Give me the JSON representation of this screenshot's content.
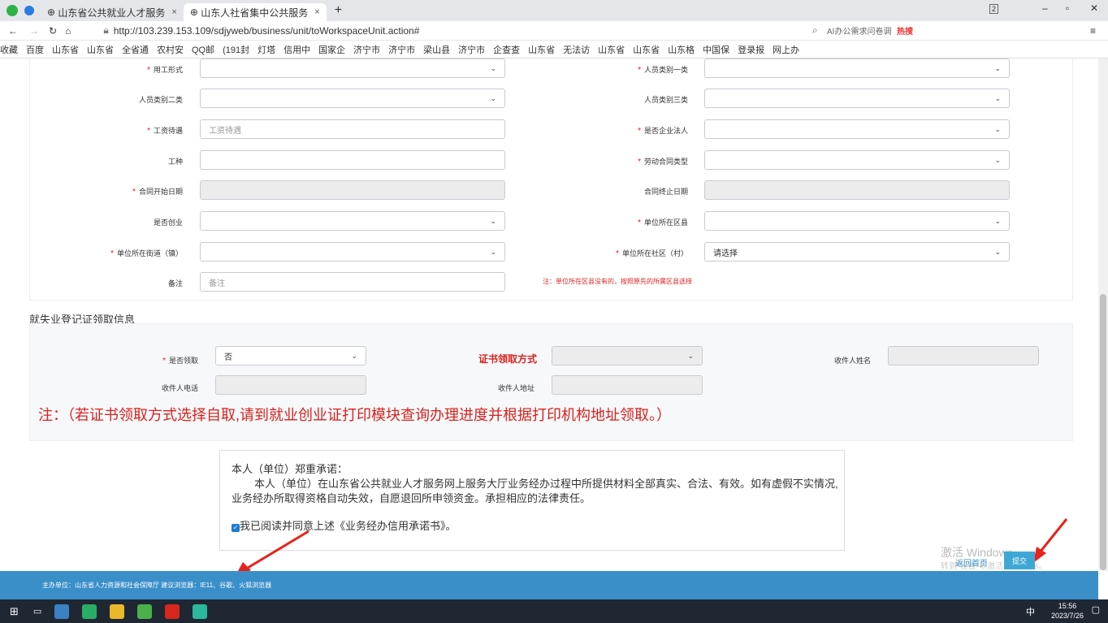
{
  "browser": {
    "tabs": [
      {
        "label": "山东省公共就业人才服务",
        "active": false
      },
      {
        "label": "山东人社省集中公共服务",
        "active": true
      }
    ],
    "new_tab": "+",
    "url": "http://103.239.153.109/sdjyweb/business/unit/toWorkspaceUnit.action#",
    "search_hint": "AI办公需求问卷调",
    "hot_label": "热搜",
    "window_badge": "2",
    "bookmarks": [
      "收藏",
      "百度",
      "山东省",
      "山东省",
      "全省通",
      "农村安",
      "QQ邮",
      "(191封",
      "灯塔",
      "信用中",
      "国家企",
      "济宁市",
      "济宁市",
      "梁山县",
      "济宁市",
      "企查查",
      "山东省",
      "无法访",
      "山东省",
      "山东省",
      "山东格",
      "中国保",
      "登录报",
      "网上办"
    ]
  },
  "form": {
    "fields": [
      {
        "label": "用工形式",
        "required": true,
        "value": "",
        "type": "select"
      },
      {
        "label": "人员类别一类",
        "required": true,
        "value": "",
        "type": "select"
      },
      {
        "label": "人员类别二类",
        "required": false,
        "value": "",
        "type": "select"
      },
      {
        "label": "人员类别三类",
        "required": false,
        "value": "",
        "type": "select"
      },
      {
        "label": "工资待遇",
        "required": true,
        "placeholder": "工资待遇",
        "type": "text"
      },
      {
        "label": "是否企业法人",
        "required": true,
        "value": "",
        "type": "select"
      },
      {
        "label": "工种",
        "required": false,
        "value": "",
        "type": "text"
      },
      {
        "label": "劳动合同类型",
        "required": true,
        "value": "",
        "type": "select"
      },
      {
        "label": "合同开始日期",
        "required": true,
        "value": "",
        "type": "disabled"
      },
      {
        "label": "合同终止日期",
        "required": false,
        "value": "",
        "type": "disabled"
      },
      {
        "label": "是否创业",
        "required": false,
        "value": "",
        "type": "select"
      },
      {
        "label": "单位所在区县",
        "required": true,
        "value": "",
        "type": "select"
      },
      {
        "label": "单位所在街道（镇）",
        "required": true,
        "value": "",
        "type": "select"
      },
      {
        "label": "单位所在社区（村）",
        "required": true,
        "value": "请选择",
        "type": "select"
      },
      {
        "label": "备注",
        "required": false,
        "placeholder": "备注",
        "type": "text"
      }
    ],
    "district_note": "注：单位所在区县没有的，按照原先的所属区县选择"
  },
  "cert_section": {
    "title": "就失业登记证领取信息",
    "receive_label": "是否领取",
    "receive_value": "否",
    "method_label": "证书领取方式",
    "recipient_name_label": "收件人姓名",
    "recipient_phone_label": "收件人电话",
    "recipient_addr_label": "收件人地址",
    "note": "注：（若证书领取方式选择自取,请到就业创业证打印模块查询办理进度并根据打印机构地址领取。）"
  },
  "promise": {
    "heading": "本人（单位）郑重承诺：",
    "body1": "本人（单位）在山东省公共就业人才服务网上服务大厅业务经办过程中所提供材料全部真实、合法、有效。如有虚假不实情况,",
    "body2": "业务经办所取得资格自动失效，自愿退回所申领资金。承担相应的法律责任。",
    "agree": "我已阅读并同意上述《业务经办信用承诺书》。",
    "agreed": true
  },
  "actions": {
    "back": "返回首页",
    "submit": "提交"
  },
  "footer": {
    "text": "主办单位：山东省人力资源和社会保障厅  建议浏览器：IE11、谷歌、火狐浏览器"
  },
  "watermark": {
    "line1": "激活 Windows",
    "line2": "转到\"设置\"以激活 Windows。"
  },
  "taskbar": {
    "ime": "中",
    "time": "15:56",
    "date": "2023/7/26"
  }
}
